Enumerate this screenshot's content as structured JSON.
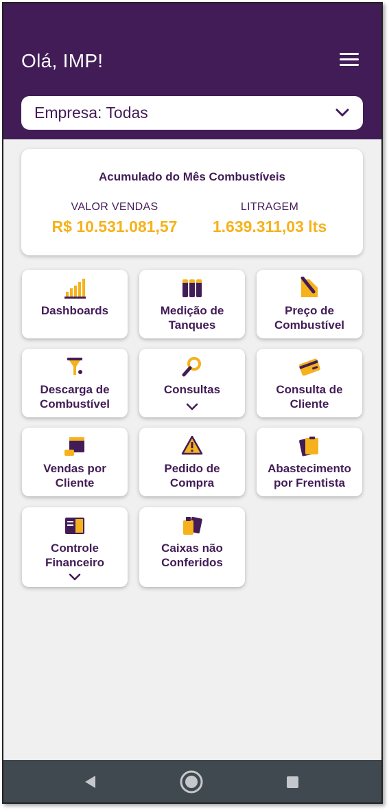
{
  "header": {
    "greeting": "Olá, IMP!",
    "menu_icon": "hamburger-menu-icon",
    "company_select": {
      "label": "Empresa: Todas",
      "icon": "chevron-down-icon"
    }
  },
  "summary": {
    "title": "Acumulado do Mês Combustíveis",
    "sales": {
      "label": "VALOR VENDAS",
      "value": "R$ 10.531.081,57"
    },
    "volume": {
      "label": "LITRAGEM",
      "value": "1.639.311,03 lts"
    }
  },
  "tiles": [
    {
      "label": "Dashboards",
      "icon": "bar-chart-icon"
    },
    {
      "label": "Medição de\nTanques",
      "icon": "tanks-icon"
    },
    {
      "label": "Preço de\nCombustível",
      "icon": "price-tag-icon"
    },
    {
      "label": "Descarga de\nCombustível",
      "icon": "funnel-icon"
    },
    {
      "label": "Consultas",
      "icon": "magnifier-icon",
      "expand_icon": "chevron-down-icon"
    },
    {
      "label": "Consulta de\nCliente",
      "icon": "credit-card-icon"
    },
    {
      "label": "Vendas por\nCliente",
      "icon": "calendar-coins-icon"
    },
    {
      "label": "Pedido de\nCompra",
      "icon": "warning-icon"
    },
    {
      "label": "Abastecimento\npor Frentista",
      "icon": "clipboard-icon"
    },
    {
      "label": "Controle\nFinanceiro",
      "icon": "ledger-book-icon",
      "expand_icon": "chevron-down-icon"
    },
    {
      "label": "Caixas não\nConferidos",
      "icon": "cash-bag-icon"
    }
  ],
  "navbar": {
    "back_icon": "back-triangle-icon",
    "home_icon": "home-circle-icon",
    "recents_icon": "recents-square-icon"
  },
  "colors": {
    "primary": "#421c57",
    "accent": "#f5b21c",
    "background": "#f0f0f0",
    "navbar": "#404850"
  }
}
